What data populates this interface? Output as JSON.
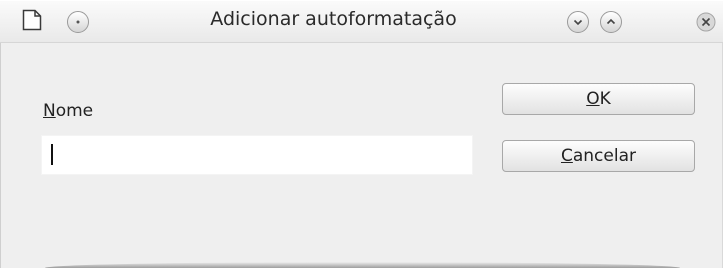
{
  "window": {
    "title": "Adicionar autoformatação"
  },
  "form": {
    "name_label_mnemonic": "N",
    "name_label_rest": "ome",
    "name_value": ""
  },
  "buttons": {
    "ok_mnemonic": "O",
    "ok_rest": "K",
    "cancel_mnemonic": "C",
    "cancel_rest": "ancelar"
  },
  "icons": {
    "document": "document-icon",
    "menu": "window-menu-icon",
    "minimize": "chevron-down-icon",
    "maximize": "chevron-up-icon",
    "close": "close-icon"
  }
}
